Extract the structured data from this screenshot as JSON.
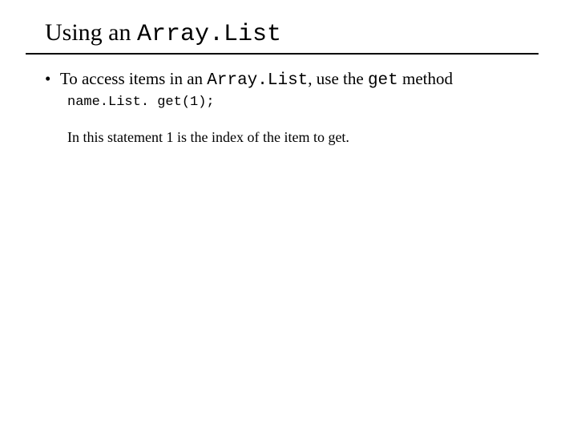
{
  "title": {
    "prefix": "Using an ",
    "code": "Array.List"
  },
  "bullet": {
    "marker": "•",
    "t1": " To access items in an ",
    "code1": "Array.List",
    "t2": ", use the ",
    "code2": "get",
    "t3": " method"
  },
  "codeline": "name.List. get(1);",
  "note": "In this statement 1 is the index of the item to get."
}
